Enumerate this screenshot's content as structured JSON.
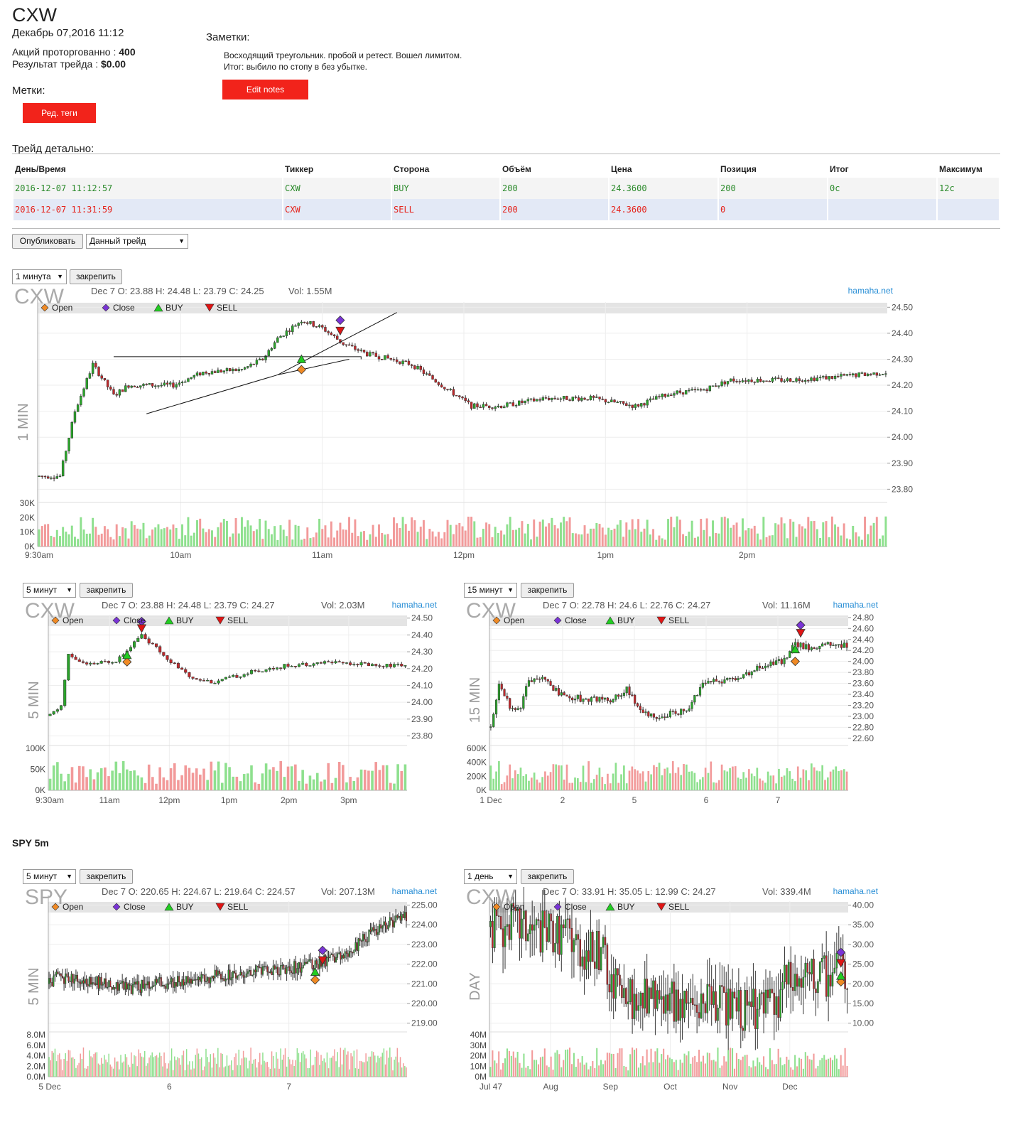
{
  "header": {
    "ticker": "CXW",
    "date": "Декабрь 07,2016 11:12",
    "shares_label": "Акций проторгованно : ",
    "shares_value": "400",
    "result_label": "Результат трейда : ",
    "result_value": "$0.00"
  },
  "tags": {
    "title": "Метки:",
    "edit_button": "Ред. теги"
  },
  "notes": {
    "title": "Заметки:",
    "line1": "Восходящий треугольник. пробой и ретест. Вошел лимитом.",
    "line2": "Итог: выбило по стопу в без убытке.",
    "edit_button": "Edit notes"
  },
  "trade_detail": {
    "title": "Трейд детально:",
    "columns": [
      "День/Время",
      "Тиккер",
      "Сторона",
      "Объём",
      "Цена",
      "Позиция",
      "Итог",
      "Максимум"
    ],
    "rows": [
      [
        "2016-12-07 11:12:57",
        "CXW",
        "BUY",
        "200",
        "24.3600",
        "200",
        "0c",
        "12c"
      ],
      [
        "2016-12-07 11:31:59",
        "CXW",
        "SELL",
        "200",
        "24.3600",
        "0",
        "",
        ""
      ]
    ]
  },
  "publish": {
    "button": "Опубликовать",
    "select_value": "Данный трейд"
  },
  "pin_label": "закрепить",
  "legend": {
    "open": "Open",
    "close": "Close",
    "buy": "BUY",
    "sell": "SELL"
  },
  "watermark": "hamaha.net",
  "colors": {
    "up": "#2aa52a",
    "down": "#c0282b",
    "open": "#f08a24",
    "close": "#7a34d6",
    "buy": "#22cc22",
    "sell": "#e01515",
    "red_button": "#f2231b"
  },
  "spy_title": "SPY 5m",
  "chart_data": [
    {
      "type": "candlestick",
      "interval": "1 минута",
      "symbol": "CXW",
      "ohlc_label": "Dec 7 O: 23.88 H: 24.48 L: 23.79 C: 24.25",
      "vol_label": "Vol: 1.55M",
      "side_label": "1 MIN",
      "ylim": [
        23.76,
        24.52
      ],
      "y_ticks": [
        "24.50",
        "24.40",
        "24.30",
        "24.20",
        "24.10",
        "24.00",
        "23.90",
        "23.80"
      ],
      "vol_ticks": [
        "30K",
        "20K",
        "10K",
        "0K"
      ],
      "x_ticks": [
        "9:30am",
        "10am",
        "11am",
        "12pm",
        "1pm",
        "2pm"
      ],
      "anchors": [
        [
          0,
          23.85
        ],
        [
          7,
          23.85
        ],
        [
          12,
          24.1
        ],
        [
          18,
          24.28
        ],
        [
          25,
          24.16
        ],
        [
          30,
          24.2
        ],
        [
          45,
          24.2
        ],
        [
          55,
          24.25
        ],
        [
          68,
          24.26
        ],
        [
          75,
          24.3
        ],
        [
          80,
          24.38
        ],
        [
          88,
          24.45
        ],
        [
          95,
          24.42
        ],
        [
          102,
          24.36
        ],
        [
          110,
          24.32
        ],
        [
          118,
          24.3
        ],
        [
          125,
          24.28
        ],
        [
          135,
          24.2
        ],
        [
          145,
          24.12
        ],
        [
          155,
          24.12
        ],
        [
          170,
          24.15
        ],
        [
          185,
          24.15
        ],
        [
          200,
          24.12
        ],
        [
          212,
          24.17
        ],
        [
          222,
          24.18
        ],
        [
          232,
          24.22
        ],
        [
          250,
          24.22
        ],
        [
          265,
          24.23
        ],
        [
          285,
          24.25
        ]
      ],
      "n": 285,
      "seed": 7,
      "noise": 0.025,
      "markers": {
        "open": [
          88,
          24.26
        ],
        "buy": [
          88,
          24.3
        ],
        "close": [
          101,
          24.45
        ],
        "sell": [
          101,
          24.41
        ]
      },
      "trendlines": [
        [
          [
            36,
            24.09
          ],
          [
            80,
            24.24
          ],
          [
            120,
            24.48
          ]
        ],
        [
          [
            80,
            24.24
          ],
          [
            104,
            24.3
          ]
        ],
        [
          [
            25,
            24.31
          ],
          [
            108,
            24.31
          ],
          [
            108,
            24.3
          ]
        ]
      ],
      "vol_max": 30
    },
    {
      "type": "candlestick",
      "interval": "5 минут",
      "symbol": "CXW",
      "ohlc_label": "Dec 7 O: 23.88 H: 24.48 L: 23.79 C: 24.27",
      "vol_label": "Vol: 2.03M",
      "side_label": "5 MIN",
      "ylim": [
        23.76,
        24.52
      ],
      "y_ticks": [
        "24.50",
        "24.40",
        "24.30",
        "24.20",
        "24.10",
        "24.00",
        "23.90",
        "23.80"
      ],
      "vol_ticks": [
        "100K",
        "50K",
        "0K"
      ],
      "x_ticks": [
        "9:30am",
        "11am",
        "12pm",
        "1pm",
        "2pm",
        "3pm"
      ],
      "anchors": [
        [
          0,
          23.92
        ],
        [
          3,
          23.98
        ],
        [
          5,
          24.28
        ],
        [
          10,
          24.22
        ],
        [
          18,
          24.25
        ],
        [
          25,
          24.4
        ],
        [
          30,
          24.3
        ],
        [
          38,
          24.15
        ],
        [
          45,
          24.12
        ],
        [
          55,
          24.18
        ],
        [
          65,
          24.22
        ],
        [
          78,
          24.24
        ],
        [
          90,
          24.22
        ],
        [
          98,
          24.22
        ]
      ],
      "n": 98,
      "seed": 11,
      "noise": 0.03,
      "markers": {
        "open": [
          21,
          24.24
        ],
        "buy": [
          21,
          24.28
        ],
        "close": [
          25,
          24.48
        ],
        "sell": [
          25,
          24.44
        ]
      },
      "trendlines": [],
      "vol_max": 100
    },
    {
      "type": "candlestick",
      "interval": "15 минут",
      "symbol": "CXW",
      "ohlc_label": "Dec 7 O: 22.78 H: 24.6 L: 22.76 C: 24.27",
      "vol_label": "Vol: 11.16M",
      "side_label": "15 MIN",
      "ylim": [
        22.52,
        24.85
      ],
      "y_ticks": [
        "24.80",
        "24.60",
        "24.40",
        "24.20",
        "24.00",
        "23.80",
        "23.60",
        "23.40",
        "23.20",
        "23.00",
        "22.80",
        "22.60"
      ],
      "vol_ticks": [
        "600K",
        "400K",
        "200K",
        "0K"
      ],
      "x_ticks": [
        "1 Dec",
        "2",
        "5",
        "6",
        "7"
      ],
      "anchors": [
        [
          0,
          22.8
        ],
        [
          3,
          23.6
        ],
        [
          7,
          23.2
        ],
        [
          11,
          23.1
        ],
        [
          13,
          23.6
        ],
        [
          20,
          23.7
        ],
        [
          25,
          23.4
        ],
        [
          35,
          23.3
        ],
        [
          45,
          23.3
        ],
        [
          50,
          23.5
        ],
        [
          55,
          23.1
        ],
        [
          60,
          23.0
        ],
        [
          72,
          23.1
        ],
        [
          78,
          23.6
        ],
        [
          90,
          23.7
        ],
        [
          100,
          23.9
        ],
        [
          107,
          24.0
        ],
        [
          112,
          24.3
        ],
        [
          117,
          24.25
        ],
        [
          125,
          24.3
        ],
        [
          132,
          24.3
        ]
      ],
      "n": 132,
      "seed": 19,
      "noise": 0.05,
      "markers": {
        "open": [
          112,
          24.0
        ],
        "buy": [
          112,
          24.22
        ],
        "close": [
          114,
          24.66
        ],
        "sell": [
          114,
          24.52
        ]
      },
      "trendlines": [],
      "vol_max": 700
    },
    {
      "type": "candlestick",
      "interval": "5 минут",
      "symbol": "SPY",
      "ohlc_label": "Dec 7 O: 220.65 H: 224.67 L: 219.64 C: 224.57",
      "vol_label": "Vol: 207.13M",
      "side_label": "5 MIN",
      "ylim": [
        218.7,
        225.2
      ],
      "y_ticks": [
        "225.00",
        "224.00",
        "223.00",
        "222.00",
        "221.00",
        "220.00",
        "219.00"
      ],
      "vol_ticks": [
        "8.0M",
        "6.0M",
        "4.0M",
        "2.0M",
        "0.0M"
      ],
      "x_ticks": [
        "5 Dec",
        "6",
        "7"
      ],
      "anchors": [
        [
          0,
          221.0
        ],
        [
          5,
          221.3
        ],
        [
          20,
          221.2
        ],
        [
          40,
          221.0
        ],
        [
          55,
          220.8
        ],
        [
          70,
          221.0
        ],
        [
          95,
          221.2
        ],
        [
          120,
          221.5
        ],
        [
          155,
          221.7
        ],
        [
          175,
          222.0
        ],
        [
          190,
          222.2
        ],
        [
          205,
          222.9
        ],
        [
          215,
          223.6
        ],
        [
          225,
          224.0
        ],
        [
          235,
          224.3
        ],
        [
          240,
          224.5
        ]
      ],
      "n": 240,
      "seed": 23,
      "noise": 0.1,
      "markers": {
        "open": [
          178,
          221.2
        ],
        "buy": [
          178,
          221.6
        ],
        "close": [
          183,
          222.7
        ],
        "sell": [
          183,
          222.2
        ]
      },
      "trendlines": [],
      "vol_max": 8.5
    },
    {
      "type": "candlestick",
      "interval": "1 день",
      "symbol": "CXW",
      "ohlc_label": "Dec 7 O: 33.91 H: 35.05 L: 12.99 C: 24.27",
      "vol_label": "Vol: 339.4M",
      "side_label": "DAY",
      "ylim": [
        8.5,
        41
      ],
      "y_ticks": [
        "40.00",
        "35.00",
        "30.00",
        "25.00",
        "20.00",
        "15.00",
        "10.00"
      ],
      "vol_ticks": [
        "40M",
        "30M",
        "20M",
        "10M",
        "0M"
      ],
      "x_ticks": [
        "Jul 47",
        "Aug",
        "Sep",
        "Oct",
        "Nov",
        "Dec"
      ],
      "anchors": [
        [
          0,
          34.5
        ],
        [
          10,
          35.0
        ],
        [
          20,
          33.8
        ],
        [
          35,
          33.0
        ],
        [
          40,
          32.0
        ],
        [
          42,
          29.5
        ],
        [
          48,
          28.5
        ],
        [
          55,
          27.0
        ],
        [
          56,
          20.0
        ],
        [
          60,
          18.5
        ],
        [
          65,
          16.0
        ],
        [
          80,
          15.5
        ],
        [
          95,
          15.2
        ],
        [
          110,
          14.0
        ],
        [
          125,
          13.5
        ],
        [
          138,
          14.0
        ],
        [
          139,
          20.0
        ],
        [
          150,
          21.0
        ],
        [
          162,
          22.5
        ],
        [
          170,
          24.0
        ],
        [
          172,
          24.0
        ]
      ],
      "n": 172,
      "seed": 31,
      "noise": 0.35,
      "markers": {
        "open": [
          168,
          20.5
        ],
        "buy": [
          168,
          22.0
        ],
        "close": [
          168,
          28.0
        ],
        "sell": [
          168,
          25.3
        ]
      },
      "trendlines": [],
      "vol_max": 45
    }
  ]
}
